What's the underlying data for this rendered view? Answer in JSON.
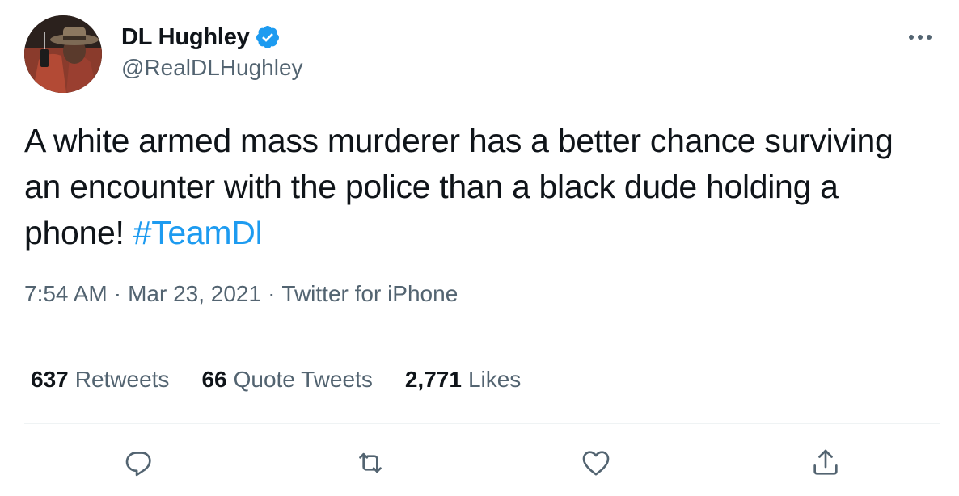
{
  "author": {
    "display_name": "DL Hughley",
    "handle": "@RealDLHughley",
    "verified": true
  },
  "tweet": {
    "text_before_hashtag": "A white armed mass murderer has a better chance surviving an encounter with the police than a black dude holding a phone! ",
    "hashtag": "#TeamDl",
    "time": "7:54 AM",
    "separator": "·",
    "date": "Mar 23, 2021",
    "source": "Twitter for iPhone"
  },
  "stats": {
    "retweets_count": "637",
    "retweets_label": "Retweets",
    "quote_count": "66",
    "quote_label": "Quote Tweets",
    "likes_count": "2,771",
    "likes_label": "Likes"
  },
  "icons": {
    "more": "more-icon",
    "reply": "reply-icon",
    "retweet": "retweet-icon",
    "like": "heart-icon",
    "share": "share-icon",
    "verified": "verified-badge-icon"
  },
  "colors": {
    "accent": "#1d9bf0",
    "text": "#0f1419",
    "secondary": "#536471",
    "divider": "#eff3f4"
  }
}
